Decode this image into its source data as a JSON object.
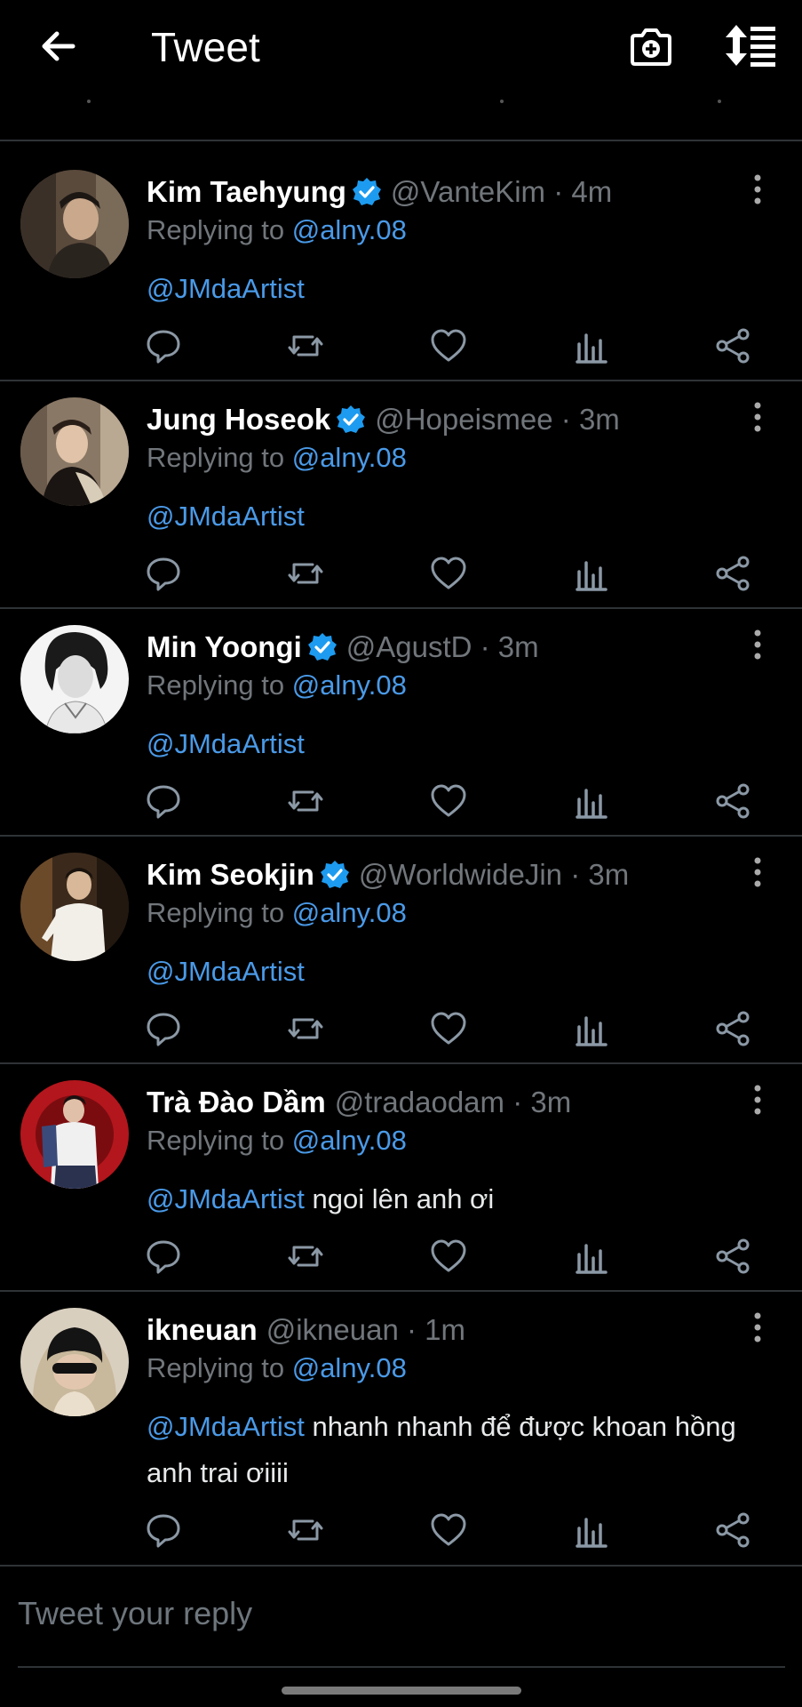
{
  "header": {
    "title": "Tweet",
    "back_icon": "arrow-left-icon",
    "camera_icon": "camera-plus-icon",
    "sort_icon": "sort-list-icon"
  },
  "colors": {
    "background": "#000000",
    "link": "#4a9ae8",
    "muted": "#71767b",
    "verified": "#1d9bf0",
    "divider": "#2f3336"
  },
  "tweets": [
    {
      "name": "Kim Taehyung",
      "verified": true,
      "handle": "@VanteKim",
      "time": "· 4m",
      "replying_label": "Replying to",
      "replying_to": "@alny.08",
      "mention": "@JMdaArtist",
      "text": ""
    },
    {
      "name": "Jung Hoseok",
      "verified": true,
      "handle": "@Hopeismee",
      "time": "· 3m",
      "replying_label": "Replying to",
      "replying_to": "@alny.08",
      "mention": "@JMdaArtist",
      "text": ""
    },
    {
      "name": "Min Yoongi",
      "verified": true,
      "handle": "@AgustD",
      "time": "· 3m",
      "replying_label": "Replying to",
      "replying_to": "@alny.08",
      "mention": "@JMdaArtist",
      "text": ""
    },
    {
      "name": "Kim Seokjin",
      "verified": true,
      "handle": "@WorldwideJin",
      "time": "· 3m",
      "replying_label": "Replying to",
      "replying_to": "@alny.08",
      "mention": "@JMdaArtist",
      "text": ""
    },
    {
      "name": "Trà Đào Dầm",
      "verified": false,
      "handle": "@tradaodam",
      "time": "· 3m",
      "replying_label": "Replying to",
      "replying_to": "@alny.08",
      "mention": "@JMdaArtist",
      "text": " ngoi lên anh ơi"
    },
    {
      "name": "ikneuan",
      "verified": false,
      "handle": "@ikneuan",
      "time": "· 1m",
      "replying_label": "Replying to",
      "replying_to": "@alny.08",
      "mention": "@JMdaArtist",
      "text": " nhanh nhanh để được khoan hồng anh trai ơiiii"
    }
  ],
  "action_icons": [
    "reply-icon",
    "retweet-icon",
    "like-icon",
    "views-icon",
    "share-icon"
  ],
  "compose": {
    "placeholder": "Tweet your reply"
  }
}
